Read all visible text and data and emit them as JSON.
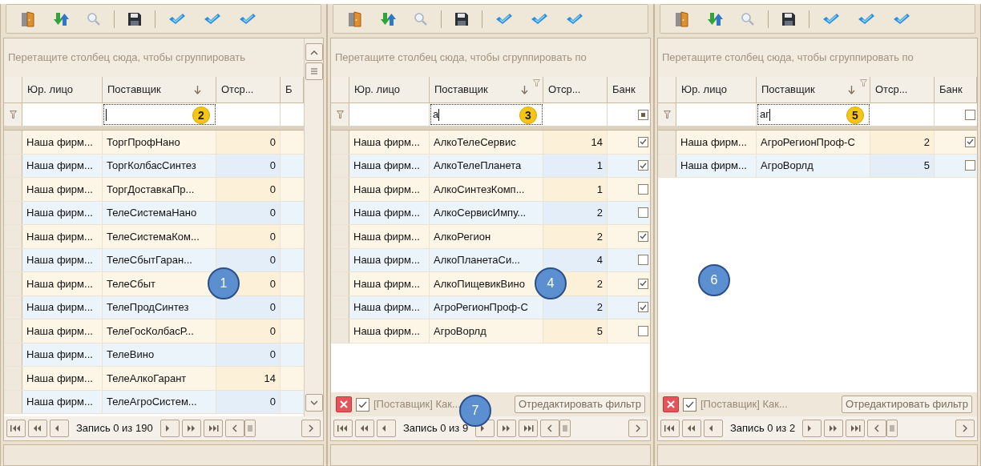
{
  "panels": [
    {
      "group_hint": "Перетащите столбец сюда, чтобы сгруппировать",
      "columns": [
        {
          "label": "Юр. лицо",
          "sorted": false,
          "filtered": false
        },
        {
          "label": "Поставщик",
          "sorted": true,
          "filtered": false
        },
        {
          "label": "Отср...",
          "sorted": false,
          "filtered": false
        },
        {
          "label": "Б",
          "sorted": false,
          "filtered": false
        }
      ],
      "filter_row": {
        "badge": "2"
      },
      "scrollbar": true,
      "callouts": [
        {
          "label": "1",
          "kind": "rows"
        }
      ],
      "rows": [
        {
          "entity": "Наша фирм...",
          "supplier": "ТоргПрофНано",
          "deferral": "0"
        },
        {
          "entity": "Наша фирм...",
          "supplier": "ТоргКолбасСинтез",
          "deferral": "0"
        },
        {
          "entity": "Наша фирм...",
          "supplier": "ТоргДоставкаПр...",
          "deferral": "0"
        },
        {
          "entity": "Наша фирм...",
          "supplier": "ТелеСистемаНано",
          "deferral": "0"
        },
        {
          "entity": "Наша фирм...",
          "supplier": "ТелеСистемаКом...",
          "deferral": "0"
        },
        {
          "entity": "Наша фирм...",
          "supplier": "ТелеСбытГаран...",
          "deferral": "0"
        },
        {
          "entity": "Наша фирм...",
          "supplier": "ТелеСбыт",
          "deferral": "0"
        },
        {
          "entity": "Наша фирм...",
          "supplier": "ТелеПродСинтез",
          "deferral": "0"
        },
        {
          "entity": "Наша фирм...",
          "supplier": "ТелеГосКолбасР...",
          "deferral": "0"
        },
        {
          "entity": "Наша фирм...",
          "supplier": "ТелеВино",
          "deferral": "0"
        },
        {
          "entity": "Наша фирм...",
          "supplier": "ТелеАлкоГарант",
          "deferral": "14"
        },
        {
          "entity": "Наша фирм...",
          "supplier": "ТелеАгроСистем...",
          "deferral": "0"
        }
      ],
      "navigator": "Запись 0 из 190"
    },
    {
      "group_hint": "Перетащите столбец сюда, чтобы сгруппировать по",
      "columns": [
        {
          "label": "Юр. лицо",
          "sorted": false,
          "filtered": false
        },
        {
          "label": "Поставщик",
          "sorted": true,
          "filtered": true
        },
        {
          "label": "Отср...",
          "sorted": false,
          "filtered": false
        },
        {
          "label": "Банк",
          "sorted": false,
          "filtered": false
        }
      ],
      "filter_row": {
        "value": "а",
        "badge": "3",
        "bank_filter_indeterminate": true
      },
      "scrollbar": false,
      "callouts": [
        {
          "label": "4",
          "kind": "rows"
        },
        {
          "label": "7",
          "kind": "filter-bar"
        }
      ],
      "rows": [
        {
          "entity": "Наша фирм...",
          "supplier": "АлкоТелеСервис",
          "deferral": "14",
          "bank_checked": true
        },
        {
          "entity": "Наша фирм...",
          "supplier": "АлкоТелеПланета",
          "deferral": "1",
          "bank_checked": true
        },
        {
          "entity": "Наша фирм...",
          "supplier": "АлкоСинтезКомп...",
          "deferral": "1",
          "bank_checked": false
        },
        {
          "entity": "Наша фирм...",
          "supplier": "АлкоСервисИмпу...",
          "deferral": "2",
          "bank_checked": false
        },
        {
          "entity": "Наша фирм...",
          "supplier": "АлкоРегион",
          "deferral": "2",
          "bank_checked": true
        },
        {
          "entity": "Наша фирм...",
          "supplier": "АлкоПланетаСи...",
          "deferral": "4",
          "bank_checked": false
        },
        {
          "entity": "Наша фирм...",
          "supplier": "АлкоПищевикВино",
          "deferral": "2",
          "bank_checked": true
        },
        {
          "entity": "Наша фирм...",
          "supplier": "АгроРегионПроф-С",
          "deferral": "2",
          "bank_checked": true
        },
        {
          "entity": "Наша фирм...",
          "supplier": "АгроВорлд",
          "deferral": "5",
          "bank_checked": false
        }
      ],
      "filter_bar": {
        "enabled": true,
        "text": "[Поставщик] Как...",
        "button": "Отредактировать фильтр"
      },
      "navigator": "Запись 0 из 9"
    },
    {
      "group_hint": "Перетащите столбец сюда, чтобы сгруппировать по",
      "columns": [
        {
          "label": "Юр. лицо",
          "sorted": false,
          "filtered": false
        },
        {
          "label": "Поставщик",
          "sorted": true,
          "filtered": true
        },
        {
          "label": "Отср...",
          "sorted": false,
          "filtered": false
        },
        {
          "label": "Банк",
          "sorted": false,
          "filtered": false
        }
      ],
      "filter_row": {
        "value": "аг",
        "badge": "5",
        "bank_filter_indeterminate": false
      },
      "scrollbar": false,
      "callouts": [
        {
          "label": "6",
          "kind": "blank"
        }
      ],
      "rows": [
        {
          "entity": "Наша фирм...",
          "supplier": "АгроРегионПроф-С",
          "deferral": "2",
          "bank_checked": true
        },
        {
          "entity": "Наша фирм...",
          "supplier": "АгроВорлд",
          "deferral": "5",
          "bank_checked": false
        }
      ],
      "filter_bar": {
        "enabled": true,
        "text": "[Поставщик] Как...",
        "button": "Отредактировать фильтр"
      },
      "navigator": "Запись 0 из 2"
    }
  ]
}
